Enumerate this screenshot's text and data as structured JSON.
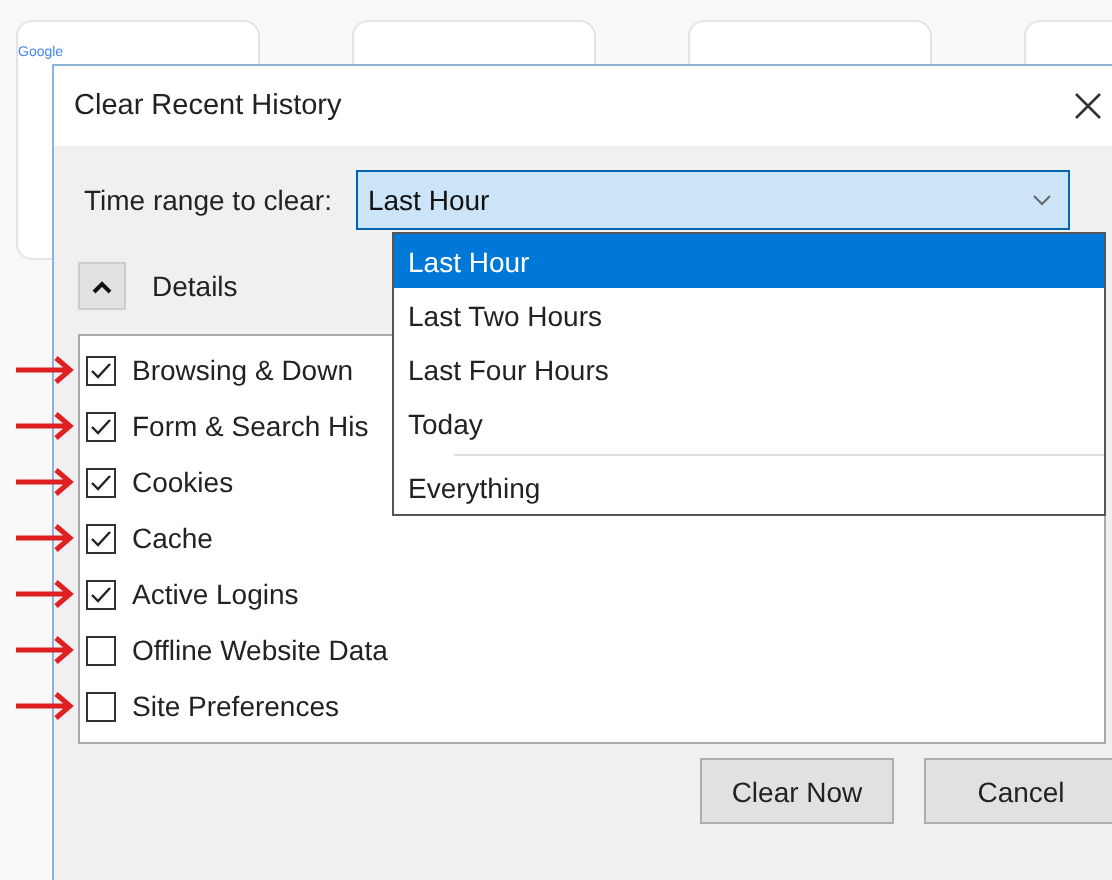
{
  "background_page": {
    "first_tile_label": "Google"
  },
  "dialog": {
    "title": "Clear Recent History",
    "time_range": {
      "label": "Time range to clear:",
      "value": "Last Hour",
      "expanded": true,
      "options": [
        {
          "label": "Last Hour",
          "selected": true,
          "separator_before": false
        },
        {
          "label": "Last Two Hours",
          "selected": false,
          "separator_before": false
        },
        {
          "label": "Last Four Hours",
          "selected": false,
          "separator_before": false
        },
        {
          "label": "Today",
          "selected": false,
          "separator_before": false
        },
        {
          "label": "Everything",
          "selected": false,
          "separator_before": true
        }
      ]
    },
    "details": {
      "label": "Details",
      "expanded": true
    },
    "items": [
      {
        "label": "Browsing & Down",
        "checked": true,
        "annotated": true
      },
      {
        "label": "Form & Search His",
        "checked": true,
        "annotated": true
      },
      {
        "label": "Cookies",
        "checked": true,
        "annotated": true
      },
      {
        "label": "Cache",
        "checked": true,
        "annotated": true
      },
      {
        "label": "Active Logins",
        "checked": true,
        "annotated": true
      },
      {
        "label": "Offline Website Data",
        "checked": false,
        "annotated": true
      },
      {
        "label": "Site Preferences",
        "checked": false,
        "annotated": true
      }
    ],
    "buttons": [
      "Clear Now",
      "Cancel"
    ]
  }
}
